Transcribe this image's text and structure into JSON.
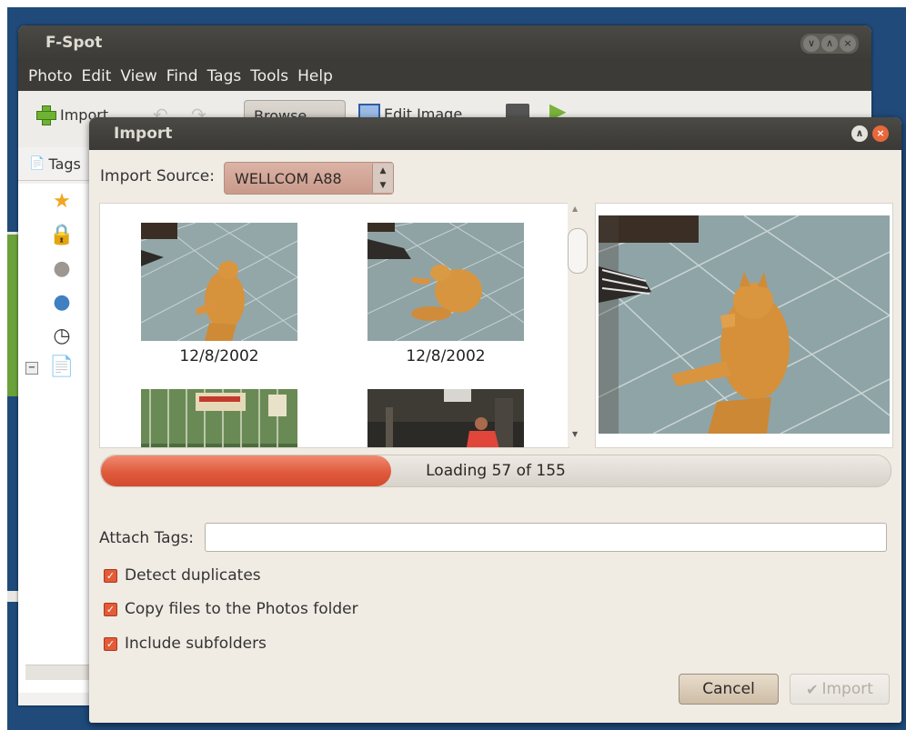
{
  "main_window": {
    "title": "F-Spot",
    "controls": [
      "minimize",
      "maximize",
      "close"
    ],
    "menu": [
      "Photo",
      "Edit",
      "View",
      "Find",
      "Tags",
      "Tools",
      "Help"
    ],
    "toolbar": {
      "import_label": "Import",
      "browse_label": "Browse",
      "edit_label": "Edit Image"
    },
    "sidebar": {
      "tags_label": "Tags"
    }
  },
  "dialog": {
    "title": "Import",
    "source_label": "Import Source:",
    "source_value": "WELLCOM A88",
    "thumbnails": [
      {
        "date": "12/8/2002"
      },
      {
        "date": "12/8/2002"
      },
      {
        "date": ""
      },
      {
        "date": ""
      }
    ],
    "progress": {
      "text": "Loading 57 of 155",
      "loaded": 57,
      "total": 155
    },
    "attach_tags_label": "Attach Tags:",
    "attach_tags_value": "",
    "options": [
      {
        "label": "Detect duplicates",
        "checked": true
      },
      {
        "label": "Copy files to the Photos folder",
        "checked": true
      },
      {
        "label": "Include subfolders",
        "checked": true
      }
    ],
    "cancel_label": "Cancel",
    "import_label": "Import"
  },
  "colors": {
    "accent": "#e05a3d",
    "titlebar": "#3c3b37",
    "dialog_bg": "#f0ebe3"
  }
}
